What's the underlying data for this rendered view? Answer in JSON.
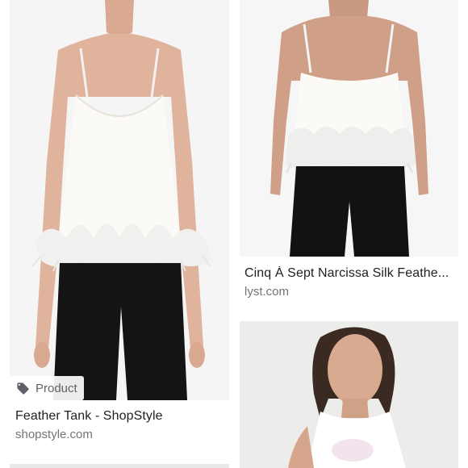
{
  "results": [
    {
      "title": "Feather Tank - ShopStyle",
      "source": "shopstyle.com",
      "badge": {
        "label": "Product",
        "icon": "tag-icon"
      }
    },
    {
      "title": "Cinq À Sept Narcissa Silk Feathe...",
      "source": "lyst.com"
    },
    {
      "title": "",
      "source": ""
    }
  ],
  "colors": {
    "title": "#202124",
    "source": "#70757a",
    "badge_bg": "#ffffff",
    "badge_text": "#5f6368"
  }
}
